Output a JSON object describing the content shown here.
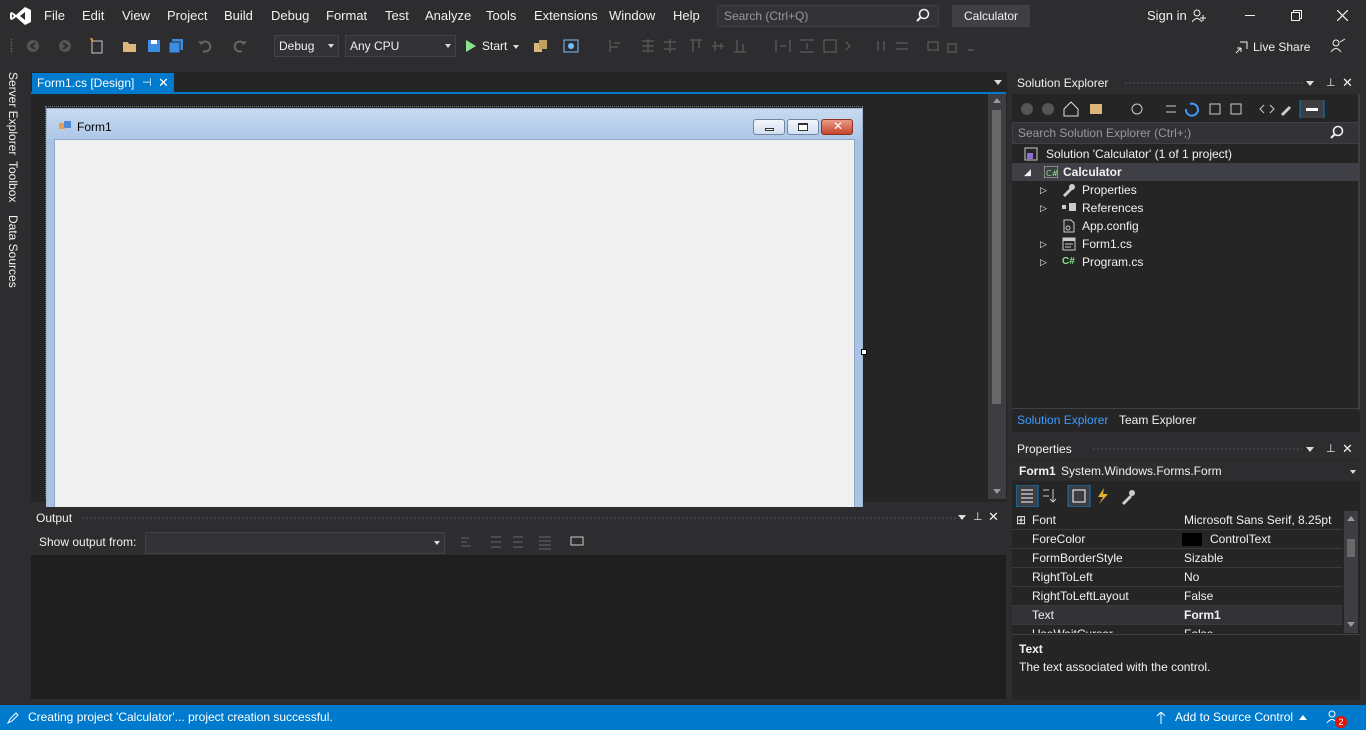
{
  "menu": [
    "File",
    "Edit",
    "View",
    "Project",
    "Build",
    "Debug",
    "Format",
    "Test",
    "Analyze",
    "Tools",
    "Extensions",
    "Window",
    "Help"
  ],
  "search": {
    "placeholder": "Search (Ctrl+Q)"
  },
  "solution_title": "Calculator",
  "account": {
    "sign_in": "Sign in"
  },
  "toolbar": {
    "config": "Debug",
    "platform": "Any CPU",
    "start": "Start",
    "live_share": "Live Share"
  },
  "left_rail": [
    "Server Explorer",
    "Toolbox",
    "Data Sources"
  ],
  "doc_tab": {
    "label": "Form1.cs [Design]"
  },
  "form": {
    "title": "Form1"
  },
  "output": {
    "title": "Output",
    "show_from": "Show output from:",
    "source": ""
  },
  "solution_explorer": {
    "title": "Solution Explorer",
    "search_placeholder": "Search Solution Explorer (Ctrl+;)",
    "solution": "Solution 'Calculator' (1 of 1 project)",
    "project": "Calculator",
    "items": [
      "Properties",
      "References",
      "App.config",
      "Form1.cs",
      "Program.cs"
    ],
    "tabs": [
      "Solution Explorer",
      "Team Explorer"
    ]
  },
  "properties": {
    "title": "Properties",
    "object_name": "Form1",
    "object_type": "System.Windows.Forms.Form",
    "rows": [
      {
        "name": "Font",
        "value": "Microsoft Sans Serif, 8.25pt"
      },
      {
        "name": "ForeColor",
        "value": "ControlText"
      },
      {
        "name": "FormBorderStyle",
        "value": "Sizable"
      },
      {
        "name": "RightToLeft",
        "value": "No"
      },
      {
        "name": "RightToLeftLayout",
        "value": "False"
      },
      {
        "name": "Text",
        "value": "Form1"
      },
      {
        "name": "UseWaitCursor",
        "value": "False"
      }
    ],
    "desc_title": "Text",
    "desc_text": "The text associated with the control."
  },
  "status": {
    "message": "Creating project 'Calculator'... project creation successful.",
    "source_control": "Add to Source Control",
    "notifications": "2"
  },
  "colors": {
    "accent": "#007acc",
    "bg": "#2d2d30",
    "panel": "#252526"
  }
}
